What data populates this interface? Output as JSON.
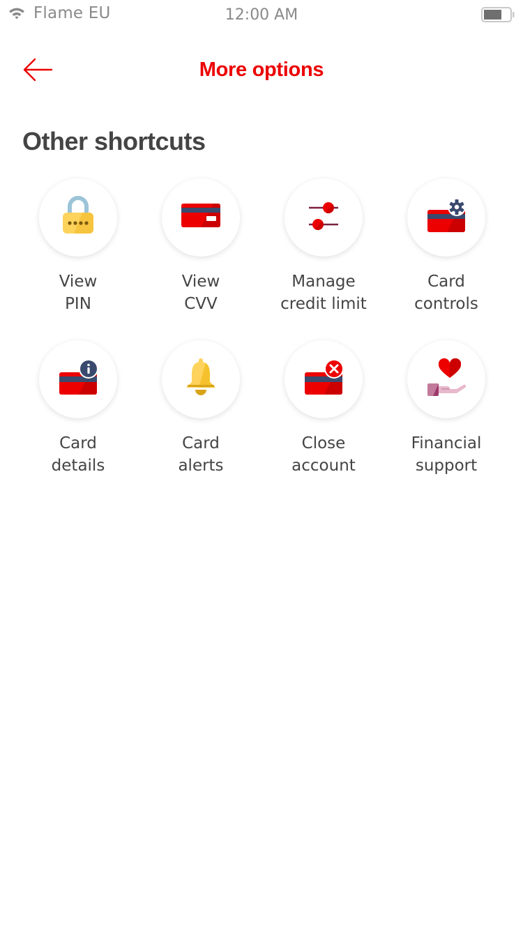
{
  "status_bar": {
    "carrier": "Flame EU",
    "time": "12:00 AM",
    "wifi_icon": "wifi-icon",
    "battery_icon": "battery-icon",
    "battery_level": 0.7
  },
  "nav": {
    "title": "More options",
    "back_icon": "arrow-left-icon"
  },
  "section": {
    "title": "Other shortcuts"
  },
  "colors": {
    "brand_red": "#ec0000",
    "text_gray": "#444444",
    "status_gray": "#8a8a8a",
    "card_navy": "#3a4a6e",
    "lock_yellow": "#fdd35b",
    "lock_shackle": "#9cc4d8"
  },
  "shortcuts": [
    {
      "id": "view-pin",
      "line1": "View",
      "line2": "PIN",
      "icon": "padlock-icon"
    },
    {
      "id": "view-cvv",
      "line1": "View",
      "line2": "CVV",
      "icon": "credit-card-icon"
    },
    {
      "id": "manage-credit-limit",
      "line1": "Manage",
      "line2": "credit limit",
      "icon": "sliders-icon"
    },
    {
      "id": "card-controls",
      "line1": "Card",
      "line2": "controls",
      "icon": "card-gear-icon"
    },
    {
      "id": "card-details",
      "line1": "Card",
      "line2": "details",
      "icon": "card-info-icon"
    },
    {
      "id": "card-alerts",
      "line1": "Card",
      "line2": "alerts",
      "icon": "bell-icon"
    },
    {
      "id": "close-account",
      "line1": "Close",
      "line2": "account",
      "icon": "card-close-icon"
    },
    {
      "id": "financial-support",
      "line1": "Financial",
      "line2": "support",
      "icon": "heart-hand-icon"
    }
  ]
}
